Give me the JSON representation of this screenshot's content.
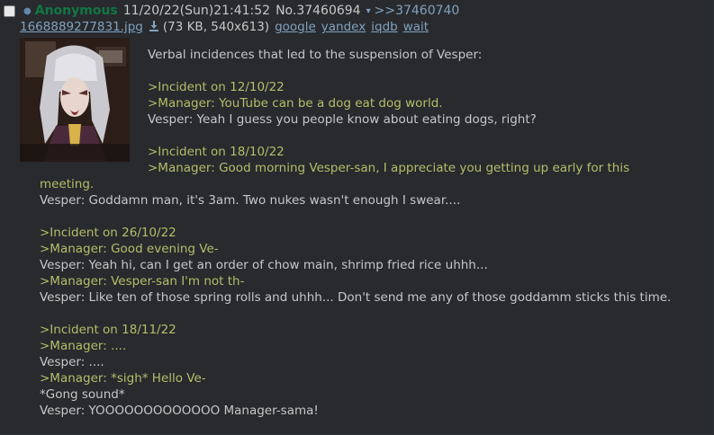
{
  "post": {
    "checkbox": "",
    "poster_name": "Anonymous",
    "datetime": "11/20/22(Sun)21:41:52",
    "post_no": "No.37460694",
    "reply_link": ">>37460740",
    "file": {
      "name": "1668889277831.jpg",
      "meta": "(73 KB, 540x613)",
      "search_links": [
        "google",
        "yandex",
        "iqdb",
        "wait"
      ]
    },
    "message": [
      {
        "text": "Verbal incidences that led to the suspension of Vesper:",
        "quote": false,
        "indent": true
      },
      {
        "text": "",
        "quote": false,
        "indent": true
      },
      {
        "text": ">Incident on 12/10/22",
        "quote": true,
        "indent": true
      },
      {
        "text": ">Manager: YouTube can be a dog eat dog world.",
        "quote": true,
        "indent": true
      },
      {
        "text": "Vesper: Yeah I guess you people know about eating dogs, right?",
        "quote": false,
        "indent": true
      },
      {
        "text": "",
        "quote": false,
        "indent": true
      },
      {
        "text": ">Incident on 18/10/22",
        "quote": true,
        "indent": true
      },
      {
        "text": ">Manager: Good morning Vesper-san, I appreciate you getting up early for this",
        "quote": true,
        "indent": true
      },
      {
        "text": "meeting.",
        "quote": true,
        "indent": false
      },
      {
        "text": "Vesper: Goddamn man, it's 3am. Two nukes wasn't enough I swear....",
        "quote": false,
        "indent": false
      },
      {
        "text": "",
        "quote": false,
        "indent": false
      },
      {
        "text": ">Incident on 26/10/22",
        "quote": true,
        "indent": false
      },
      {
        "text": ">Manager: Good evening Ve-",
        "quote": true,
        "indent": false
      },
      {
        "text": "Vesper: Yeah hi, can I get an order of chow main, shrimp fried rice uhhh...",
        "quote": false,
        "indent": false
      },
      {
        "text": ">Manager: Vesper-san I'm not th-",
        "quote": true,
        "indent": false
      },
      {
        "text": "Vesper: Like ten of those spring rolls and uhhh... Don't send me any of those goddamm sticks this time.",
        "quote": false,
        "indent": false
      },
      {
        "text": "",
        "quote": false,
        "indent": false
      },
      {
        "text": ">Incident on 18/11/22",
        "quote": true,
        "indent": false
      },
      {
        "text": ">Manager: ....",
        "quote": true,
        "indent": false
      },
      {
        "text": "Vesper: ....",
        "quote": false,
        "indent": false
      },
      {
        "text": ">Manager: *sigh* Hello Ve-",
        "quote": true,
        "indent": false
      },
      {
        "text": " *Gong sound*",
        "quote": false,
        "indent": false
      },
      {
        "text": "Vesper: YOOOOOOOOOOOOO Manager-sama!",
        "quote": false,
        "indent": false
      }
    ]
  },
  "colors": {
    "page_bg": "#1d1f21",
    "post_bg": "#282a2e",
    "text": "#c5c8c6",
    "name": "#117743",
    "link": "#81a2be",
    "greentext": "#b5bd68"
  },
  "icons": {
    "download": "download-icon",
    "menu": "chevron-down-icon",
    "id_dot": "dot-icon"
  }
}
